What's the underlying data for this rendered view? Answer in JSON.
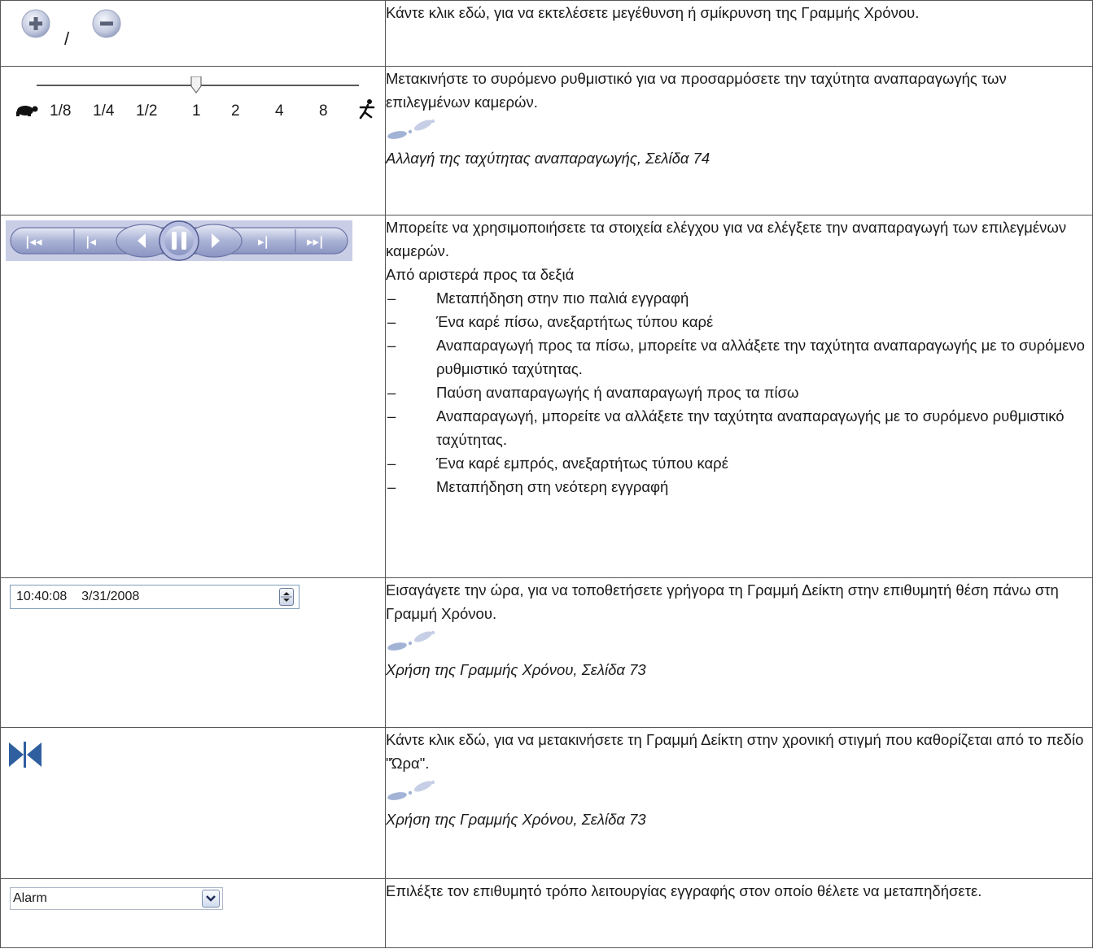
{
  "rows": [
    {
      "widget": "zoom-buttons",
      "icons": [
        "zoom-in-icon",
        "zoom-out-icon"
      ],
      "separator": "/",
      "lines": [
        "Κάντε κλικ εδώ, για να εκτελέσετε μεγέθυνση ή σμίκρυνση της Γραμμής Χρόνου."
      ]
    },
    {
      "widget": "speed-slider",
      "speed_labels": [
        "1/8",
        "1/4",
        "1/2",
        "1",
        "2",
        "4",
        "8"
      ],
      "selected_speed": "1",
      "lines": [
        "Μετακινήστε το συρόμενο ρυθμιστικό για να προσαρμόσετε την ταχύτητα αναπαραγωγής των επιλεγμένων καμερών."
      ],
      "reference": "Αλλαγή της ταχύτητας αναπαραγωγής, Σελίδα 74"
    },
    {
      "widget": "playback-controls",
      "lines": [
        " Μπορείτε να χρησιμοποιήσετε τα στοιχεία ελέγχου για να ελέγξετε την αναπαραγωγή των επιλεγμένων καμερών.",
        "Από αριστερά προς τα δεξιά"
      ],
      "bullet_marker": "–",
      "bullets": [
        "Μεταπήδηση στην πιο παλιά εγγραφή",
        "Ένα καρέ πίσω, ανεξαρτήτως τύπου καρέ",
        "Αναπαραγωγή προς τα πίσω, μπορείτε να αλλάξετε την ταχύτητα αναπαραγωγής με το συρόμενο ρυθμιστικό ταχύτητας.",
        "Παύση αναπαραγωγής ή αναπαραγωγή προς τα πίσω",
        "Αναπαραγωγή, μπορείτε να αλλάξετε την ταχύτητα αναπαραγωγής με το συρόμενο ρυθμιστικό ταχύτητας.",
        "Ένα καρέ εμπρός, ανεξαρτήτως τύπου καρέ",
        "Μεταπήδηση στη νεότερη εγγραφή"
      ]
    },
    {
      "widget": "time-field",
      "time_value": "10:40:08    3/31/2008",
      "lines": [
        "Εισαγάγετε την ώρα, για να τοποθετήσετε γρήγορα τη Γραμμή Δείκτη στην επιθυμητή θέση πάνω στη Γραμμή Χρόνου."
      ],
      "reference": "Χρήση της Γραμμής Χρόνου, Σελίδα 73"
    },
    {
      "widget": "jump-to-time",
      "lines": [
        "Κάντε κλικ εδώ, για να μετακινήσετε τη Γραμμή Δείκτη στην χρονική στιγμή που καθορίζεται από το πεδίο \"Ώρα\"."
      ],
      "reference": "Χρήση της Γραμμής Χρόνου, Σελίδα 73"
    },
    {
      "widget": "mode-select",
      "select_value": "Alarm",
      "lines": [
        "Επιλέξτε τον επιθυμητό τρόπο λειτουργίας εγγραφής στον οποίο θέλετε να μεταπηδήσετε."
      ]
    }
  ],
  "colors": {
    "border": "#555555",
    "control_blue": "#8a98c8",
    "icon_blue": "#2f5f9f"
  }
}
